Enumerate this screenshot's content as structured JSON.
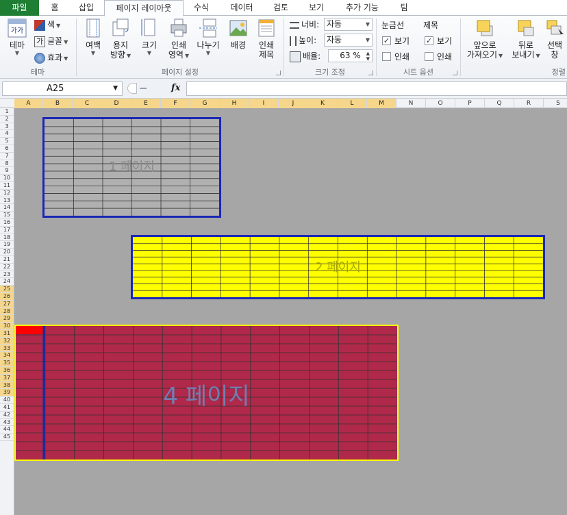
{
  "tabs": [
    {
      "label": "파일"
    },
    {
      "label": "홈"
    },
    {
      "label": "삽입"
    },
    {
      "label": "페이지 레이아웃"
    },
    {
      "label": "수식"
    },
    {
      "label": "데이터"
    },
    {
      "label": "검토"
    },
    {
      "label": "보기"
    },
    {
      "label": "추가 기능"
    },
    {
      "label": "팀"
    }
  ],
  "ribbon": {
    "theme": {
      "big_label": "테마",
      "color_label": "색",
      "font_label": "글꼴",
      "effect_label": "효과",
      "group_label": "테마"
    },
    "page_setup": {
      "margins": "여백",
      "orientation_l1": "용지",
      "orientation_l2": "방향",
      "size": "크기",
      "print_area_l1": "인쇄",
      "print_area_l2": "영역",
      "breaks": "나누기",
      "background": "배경",
      "print_titles_l1": "인쇄",
      "print_titles_l2": "제목",
      "group_label": "페이지 설정"
    },
    "scale": {
      "width_label": "너비:",
      "width_value": "자동",
      "height_label": "높이:",
      "height_value": "자동",
      "scale_label": "배율:",
      "scale_value": "63 %",
      "group_label": "크기 조정"
    },
    "sheet_options": {
      "gridlines_title": "눈금선",
      "headings_title": "제목",
      "view_label": "보기",
      "print_label": "인쇄",
      "gridlines_view": true,
      "gridlines_print": false,
      "headings_view": true,
      "headings_print": false,
      "group_label": "시트 옵션"
    },
    "arrange": {
      "bring_forward_l1": "앞으로",
      "bring_forward_l2": "가져오기",
      "send_backward_l1": "뒤로",
      "send_backward_l2": "보내기",
      "selection_l1": "선택",
      "selection_l2": "창",
      "group_label": "정렬"
    }
  },
  "formula_bar": {
    "name_box": "A25",
    "fx": "fx",
    "formula": ""
  },
  "columns": [
    "A",
    "B",
    "C",
    "D",
    "E",
    "F",
    "G",
    "H",
    "I",
    "J",
    "K",
    "L",
    "M",
    "N",
    "O",
    "P",
    "Q",
    "R",
    "S"
  ],
  "selected_columns": [
    "A",
    "B",
    "C",
    "D",
    "E",
    "F",
    "G",
    "H",
    "I",
    "J",
    "K",
    "L",
    "M"
  ],
  "rows": [
    "1",
    "2",
    "3",
    "4",
    "5",
    "6",
    "7",
    "8",
    "9",
    "10",
    "11",
    "12",
    "13",
    "14",
    "15",
    "16",
    "17",
    "18",
    "19",
    "20",
    "21",
    "22",
    "23",
    "24",
    "25",
    "26",
    "27",
    "28",
    "29",
    "30",
    "31",
    "32",
    "33",
    "34",
    "35",
    "36",
    "37",
    "38",
    "39",
    "40",
    "41",
    "42",
    "43",
    "44",
    "45"
  ],
  "selected_rows": [
    "25",
    "26",
    "27",
    "28",
    "29",
    "30",
    "31",
    "32",
    "33",
    "34",
    "35",
    "36",
    "37",
    "38",
    "39"
  ],
  "pages": [
    {
      "label": "1 페이지",
      "fill": "#b0b0b0",
      "border": "#1a27b5"
    },
    {
      "label": "2 페이지",
      "fill": "#ffff00",
      "border": "#1a27b5"
    },
    {
      "label": "4 페이지",
      "fill": "#b0284a",
      "border": "#ffff00"
    }
  ],
  "active_cell_color": "#ff0000",
  "page_break_color": "#1a27b5"
}
